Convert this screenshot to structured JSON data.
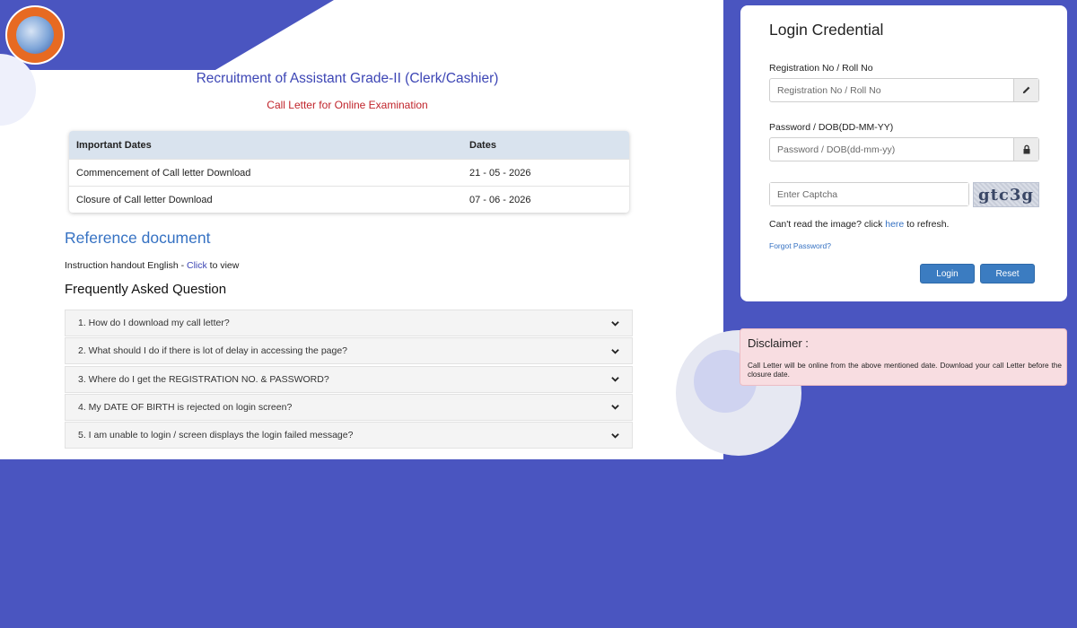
{
  "header": {
    "title": "Recruitment of Assistant Grade-II (Clerk/Cashier)",
    "subtitle": "Call Letter for Online Examination"
  },
  "dates_table": {
    "headers": [
      "Important Dates",
      "Dates"
    ],
    "rows": [
      {
        "event": "Commencement of Call letter Download",
        "date": "21 - 05 - 2026"
      },
      {
        "event": "Closure of Call letter Download",
        "date": "07 - 06 - 2026"
      }
    ]
  },
  "reference": {
    "heading": "Reference document",
    "text_before": "Instruction handout English - ",
    "link": "Click",
    "text_after": " to view"
  },
  "faq": {
    "heading": "Frequently Asked Question",
    "items": [
      "1. How do I download my call letter?",
      "2. What should I do if there is lot of delay in accessing the page?",
      "3. Where do I get the REGISTRATION NO. & PASSWORD?",
      "4. My DATE OF BIRTH is rejected on login screen?",
      "5. I am unable to login / screen displays the login failed message?"
    ]
  },
  "login": {
    "title": "Login Credential",
    "reg_label": "Registration No / Roll No",
    "reg_placeholder": "Registration No / Roll No",
    "pwd_label": "Password / DOB(DD-MM-YY)",
    "pwd_placeholder": "Password / DOB(dd-mm-yy)",
    "captcha_placeholder": "Enter Captcha",
    "captcha_text": "gtc3g",
    "refresh_before": "Can't read the image? click ",
    "refresh_link": "here",
    "refresh_after": " to refresh.",
    "forgot": "Forgot Password?",
    "login_btn": "Login",
    "reset_btn": "Reset"
  },
  "disclaimer": {
    "title": "Disclaimer :",
    "text": "Call Letter will be online from the above mentioned date. Download your call Letter before the closure date."
  },
  "colors": {
    "background": "#4a55c0",
    "title": "#3d46b5",
    "subtitle": "#c0242b",
    "button": "#3b7cc1",
    "disclaimer_bg": "#f8dde1"
  },
  "icons": {
    "reg_field": "pencil-icon",
    "pwd_field": "lock-icon",
    "faq_toggle": "chevron-down-icon"
  }
}
